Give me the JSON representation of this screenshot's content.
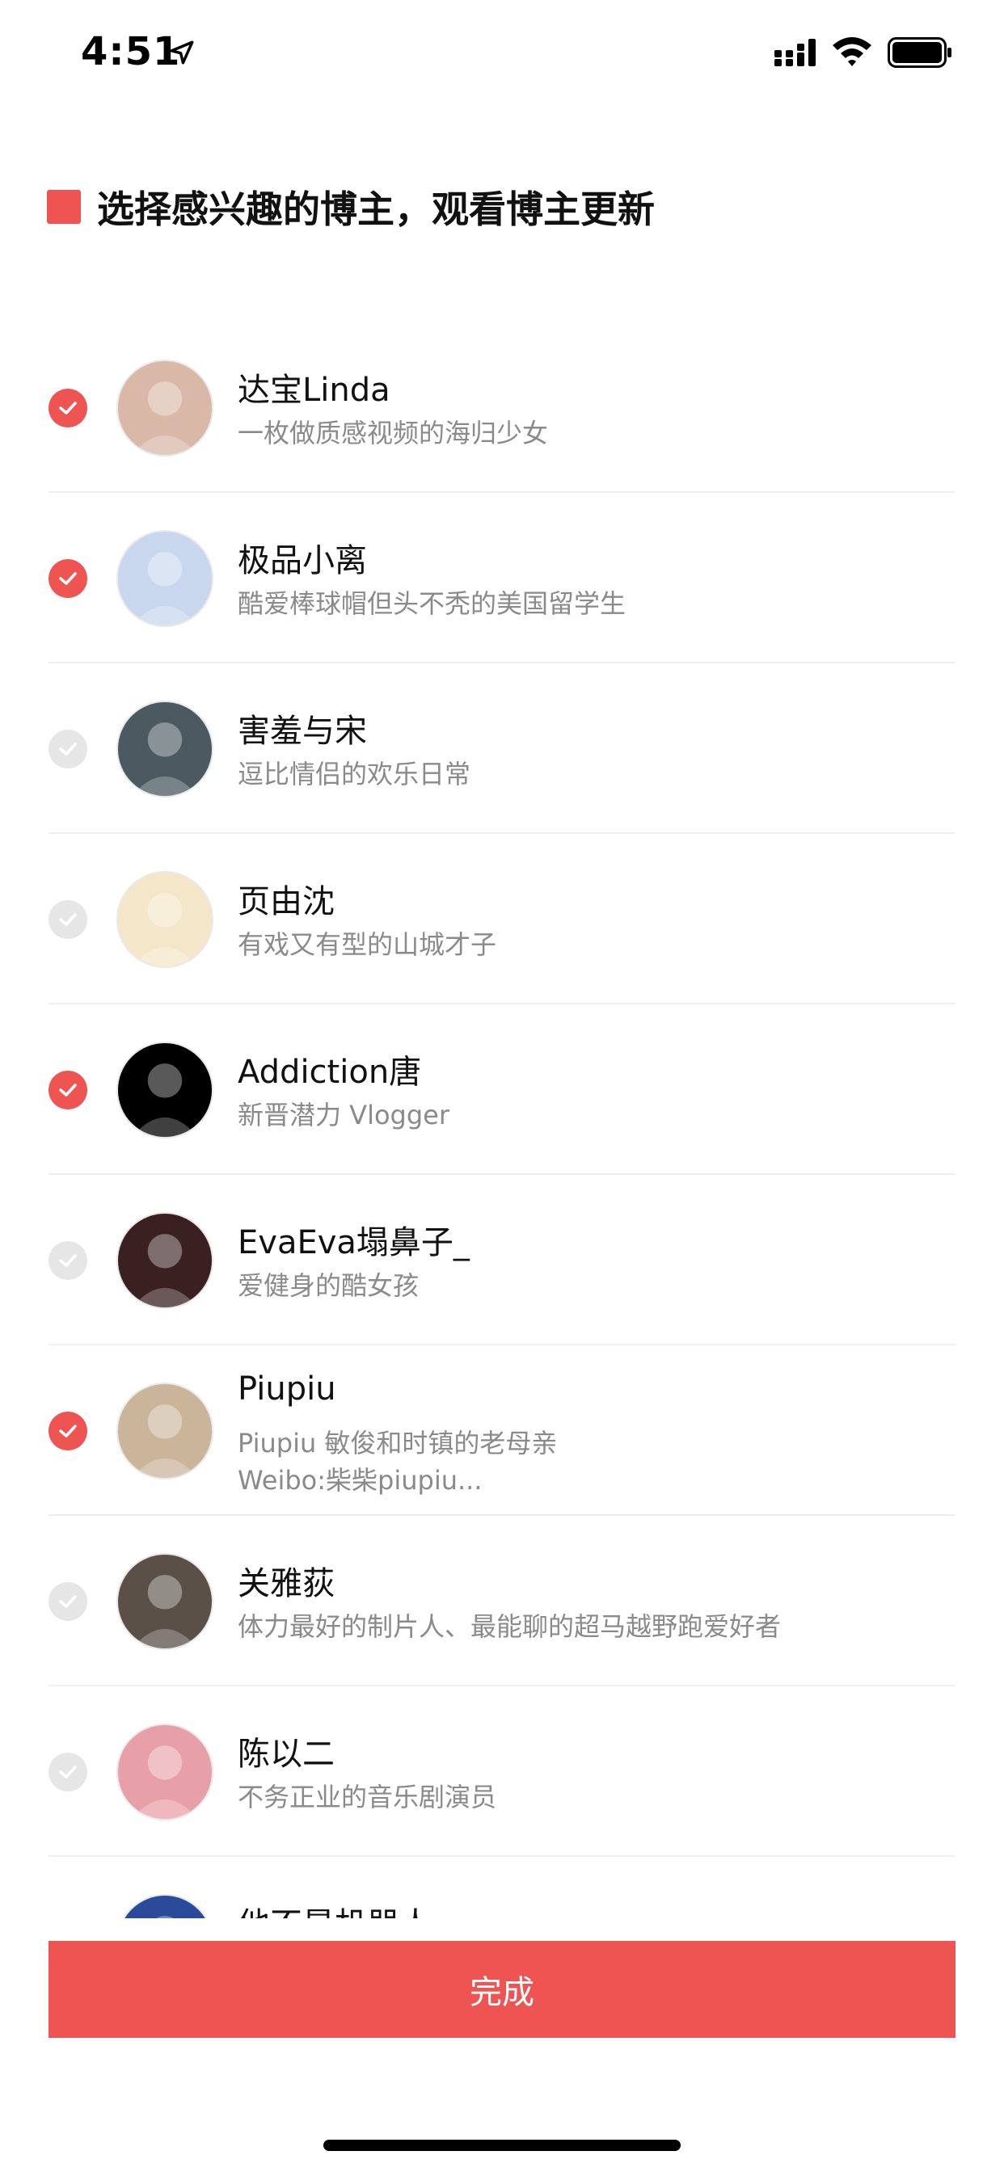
{
  "status_bar": {
    "time": "4:51"
  },
  "header": {
    "title": "选择感兴趣的博主，观看博主更新",
    "marker_color": "#ee5451"
  },
  "bloggers": [
    {
      "name": "达宝Linda",
      "desc": "一枚做质感视频的海归少女",
      "desc2": "",
      "selected": true,
      "avatar_color": "#d9b8a8"
    },
    {
      "name": "极品小离",
      "desc": "酷爱棒球帽但头不秃的美国留学生",
      "desc2": "",
      "selected": true,
      "avatar_color": "#c9d7ee"
    },
    {
      "name": "害羞与宋",
      "desc": "逗比情侣的欢乐日常",
      "desc2": "",
      "selected": false,
      "avatar_color": "#4a5a60"
    },
    {
      "name": "页由沈",
      "desc": "有戏又有型的山城才子",
      "desc2": "",
      "selected": false,
      "avatar_color": "#f4e6c8"
    },
    {
      "name": "Addiction唐",
      "desc": "新晋潜力 Vlogger",
      "desc2": "",
      "selected": true,
      "avatar_color": "#000000"
    },
    {
      "name": "EvaEva塌鼻子_",
      "desc": "爱健身的酷女孩",
      "desc2": "",
      "selected": false,
      "avatar_color": "#3a2020"
    },
    {
      "name": "Piupiu",
      "desc": "Piupiu 敏俊和时镇的老母亲",
      "desc2": "Weibo:柴柴piupiu...",
      "selected": true,
      "avatar_color": "#cbb59a"
    },
    {
      "name": "关雅荻",
      "desc": "体力最好的制片人、最能聊的超马越野跑爱好者",
      "desc2": "",
      "selected": false,
      "avatar_color": "#5a5048"
    },
    {
      "name": "陈以二",
      "desc": "不务正业的音乐剧演员",
      "desc2": "",
      "selected": false,
      "avatar_color": "#e8a0a8"
    },
    {
      "name": "他不是机器人",
      "desc": "",
      "desc2": "",
      "selected": false,
      "avatar_color": "#2a4a9a"
    }
  ],
  "done_button": {
    "label": "完成",
    "color": "#ee5451"
  }
}
